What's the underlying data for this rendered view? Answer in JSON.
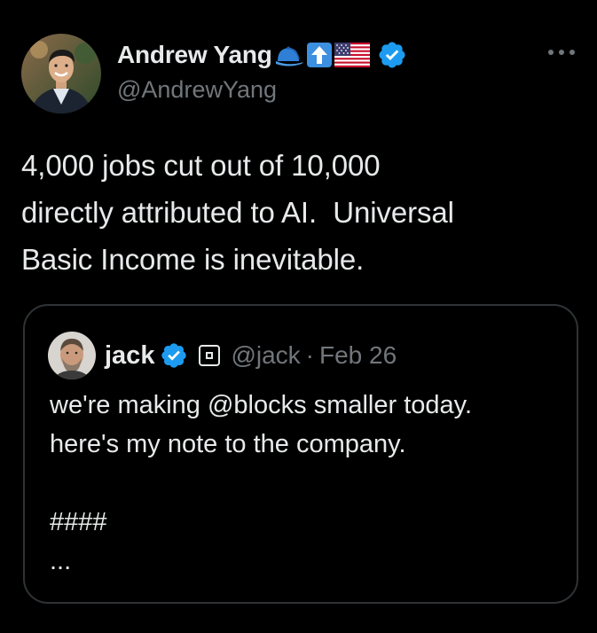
{
  "author": {
    "display_name": "Andrew Yang",
    "handle": "@AndrewYang",
    "name_emojis": [
      "blue-cap-icon",
      "up-arrow-icon",
      "us-flag-icon"
    ],
    "verified_badge": "verified-badge-icon"
  },
  "tweet": {
    "text": "4,000 jobs cut out of 10,000\ndirectly attributed to AI.  Universal\nBasic Income is inevitable."
  },
  "more_button": {
    "label": "•••"
  },
  "quote": {
    "display_name": "jack",
    "handle": "@jack",
    "separator": "·",
    "date": "Feb 26",
    "text": "we're making @blocks smaller today.\nhere's my note to the company.\n\n####\n...",
    "verified_badge": "verified-badge-icon",
    "affiliate_badge": "square-affiliate-icon"
  },
  "colors": {
    "background": "#000000",
    "text_primary": "#e7e9ea",
    "text_secondary": "#71767b",
    "verified_blue": "#1d9bf0",
    "border": "#2f3336"
  }
}
